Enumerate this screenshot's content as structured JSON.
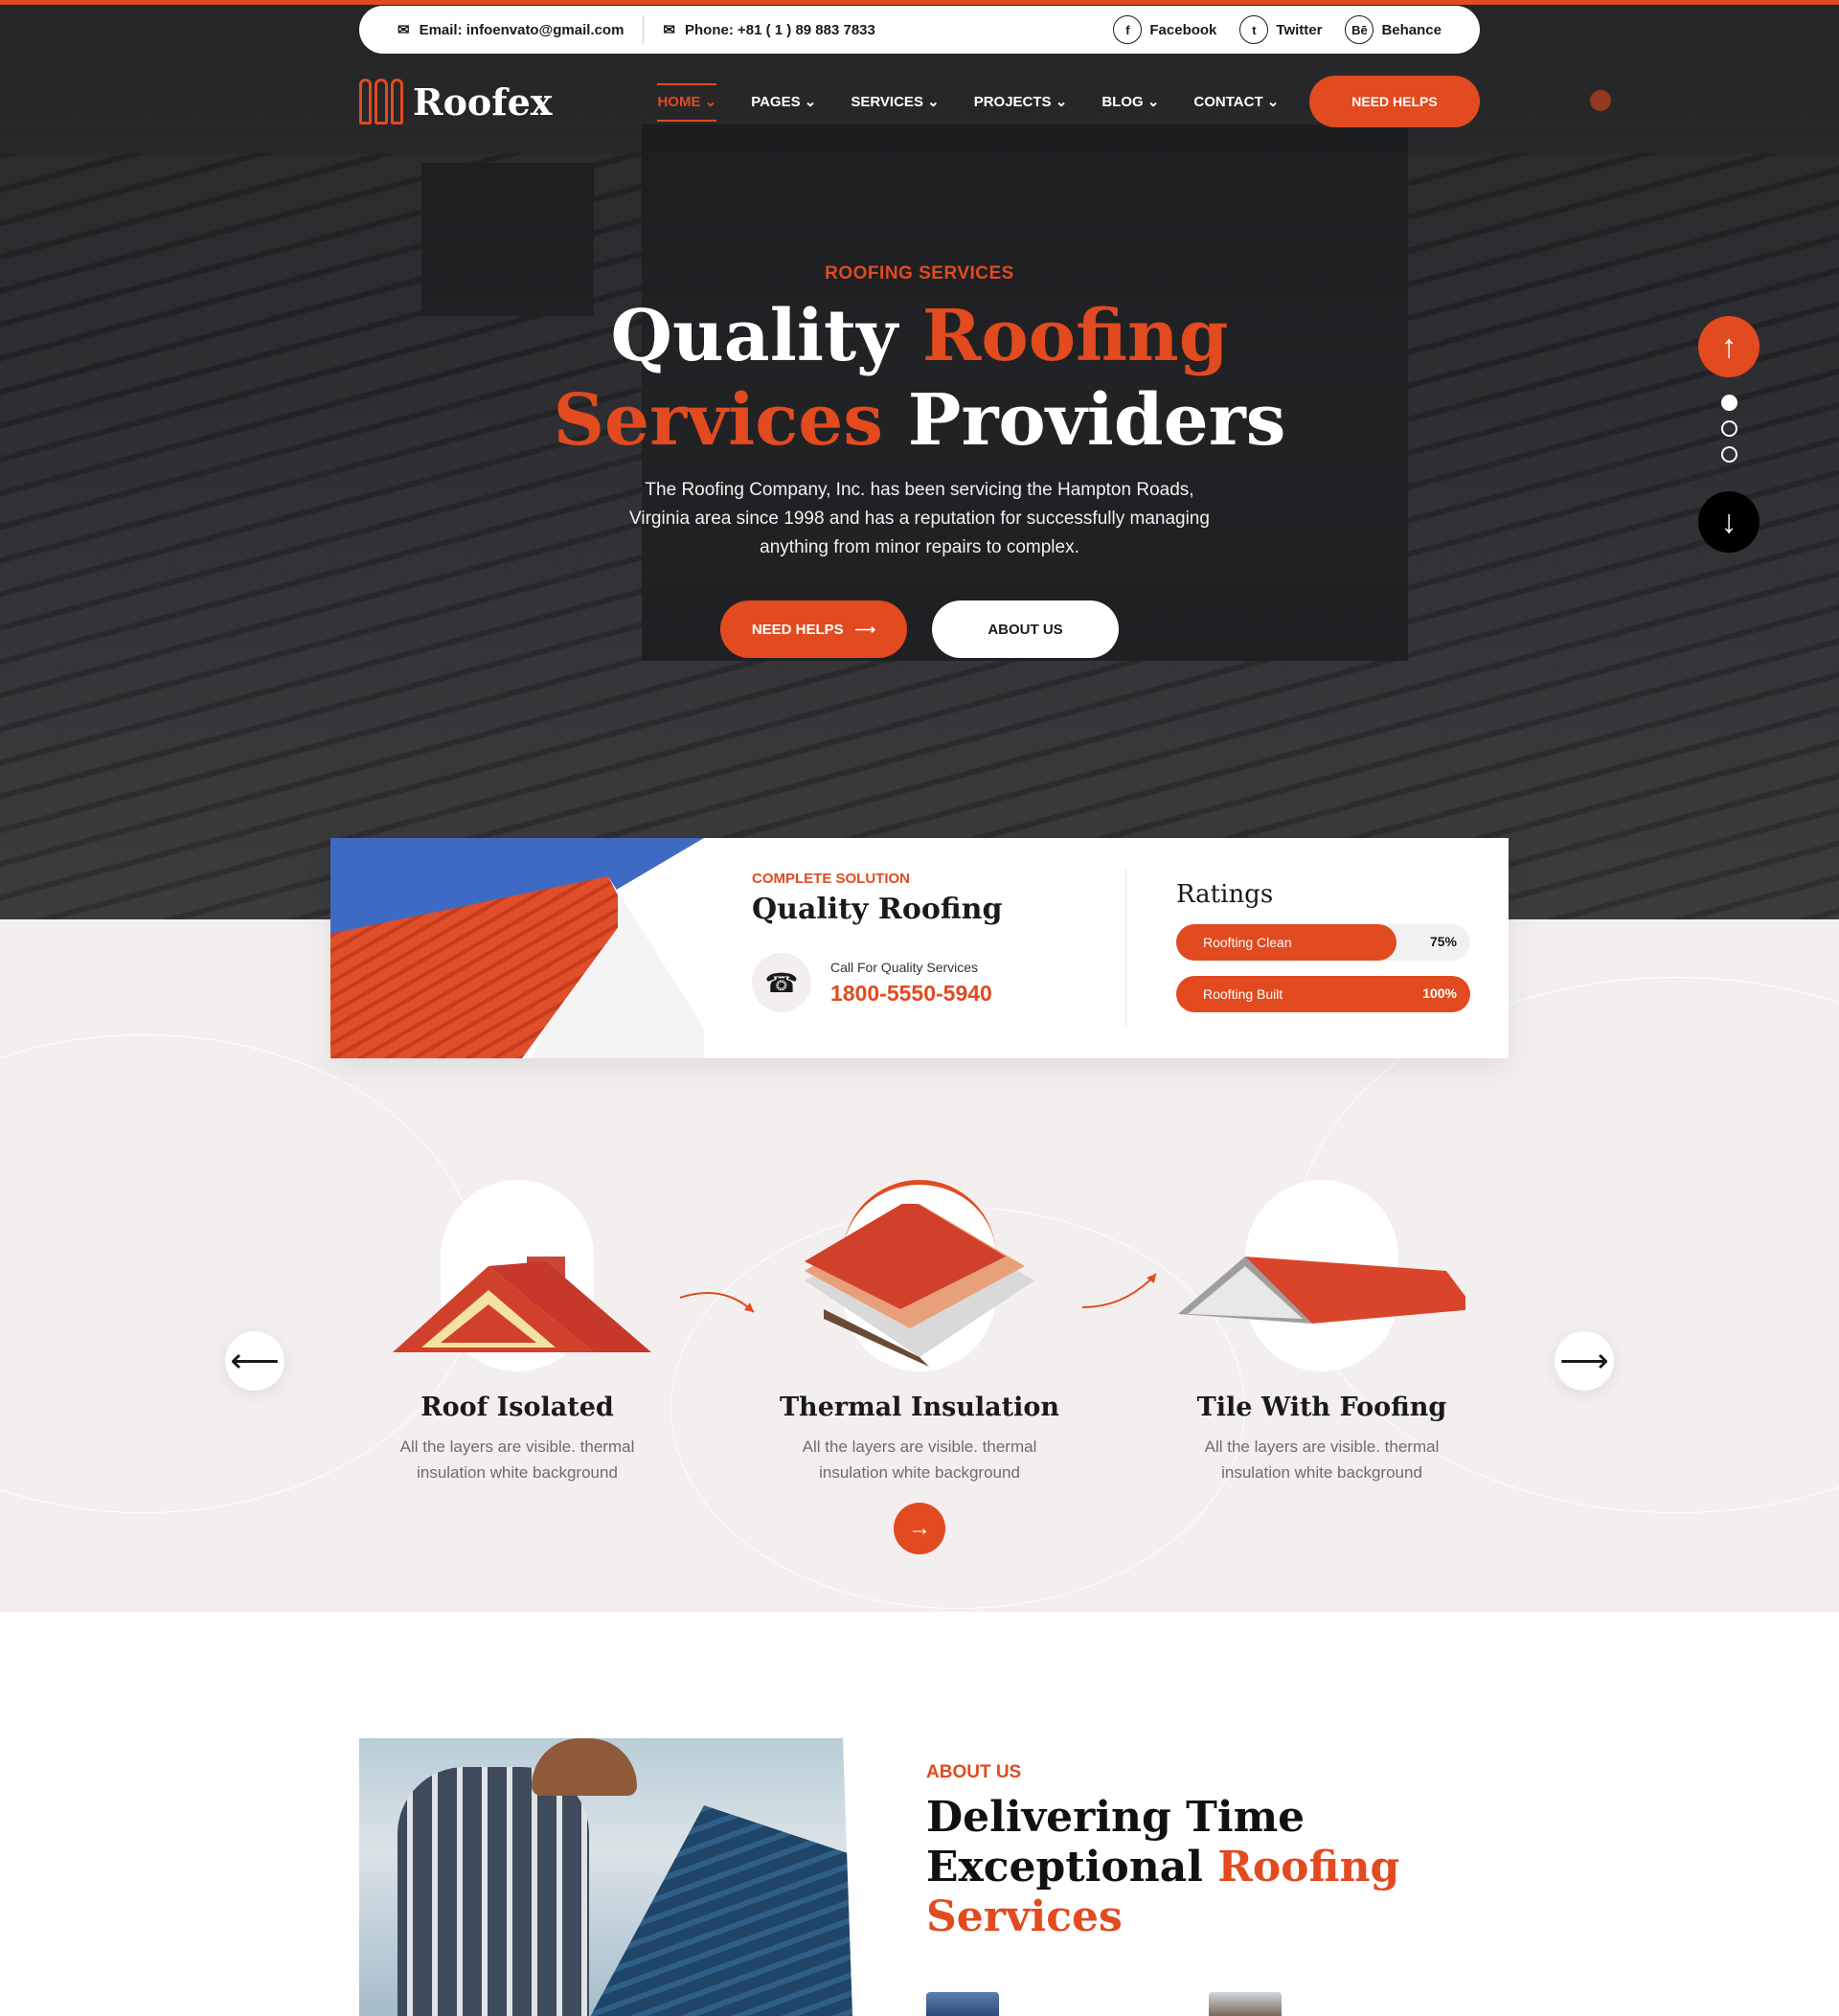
{
  "colors": {
    "accent": "#e24a1f",
    "dark": "#1a1a1a",
    "light_bg": "#f2efee"
  },
  "topbar": {
    "email": "Email: infoenvato@gmail.com",
    "phone": "Phone: +81 ( 1 ) 89 883 7833",
    "social": [
      {
        "icon": "facebook-icon",
        "glyph": "f",
        "label": "Facebook"
      },
      {
        "icon": "twitter-icon",
        "glyph": "t",
        "label": "Twitter"
      },
      {
        "icon": "behance-icon",
        "glyph": "Bē",
        "label": "Behance"
      }
    ]
  },
  "nav": {
    "logo": "Roofex",
    "items": [
      {
        "label": "HOME",
        "active": true
      },
      {
        "label": "PAGES"
      },
      {
        "label": "SERVICES"
      },
      {
        "label": "PROJECTS"
      },
      {
        "label": "BLOG"
      },
      {
        "label": "CONTACT"
      }
    ],
    "cta": "NEED HELPS"
  },
  "hero": {
    "eyebrow": "ROOFING SERVICES",
    "title_1": "Quality ",
    "title_2": "Roofing",
    "title_3": "Services",
    "title_4": " Providers",
    "description": "The Roofing Company, Inc. has been servicing the Hampton Roads, Virginia area since 1998 and has a reputation for successfully managing anything from minor repairs to complex.",
    "btn_primary": "NEED HELPS",
    "btn_secondary": "ABOUT US"
  },
  "info_card": {
    "eyebrow": "COMPLETE SOLUTION",
    "title": "Quality Roofing",
    "call_label": "Call For Quality Services",
    "call_number": "1800-5550-5940",
    "ratings_title": "Ratings",
    "ratings": [
      {
        "label": "Roofting Clean",
        "value": 75,
        "display": "75%"
      },
      {
        "label": "Roofting Built",
        "value": 100,
        "display": "100%"
      }
    ]
  },
  "services": [
    {
      "title": "Roof Isolated",
      "desc": "All the layers are visible. thermal insulation white background"
    },
    {
      "title": "Thermal Insulation",
      "desc": "All the layers are visible. thermal insulation white background"
    },
    {
      "title": "Tile With Foofing",
      "desc": "All the layers are visible. thermal insulation white background"
    }
  ],
  "about": {
    "eyebrow": "ABOUT US",
    "title_1": "Delivering Time",
    "title_2": "Exceptional ",
    "title_3": "Roofing",
    "title_4": "Services"
  }
}
